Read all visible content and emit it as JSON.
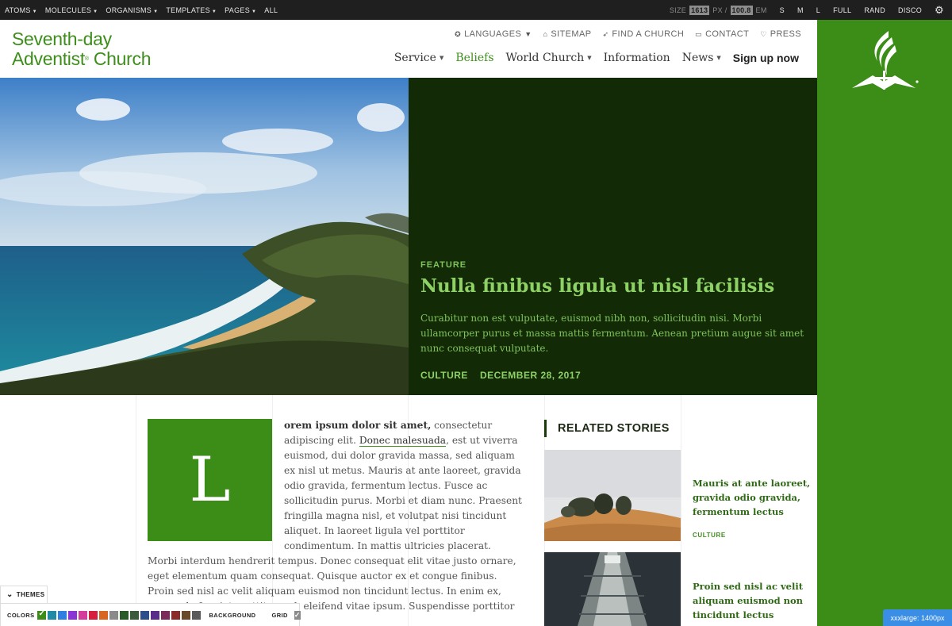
{
  "toolbar": {
    "nav": [
      {
        "label": "ATOMS",
        "has_caret": true
      },
      {
        "label": "MOLECULES",
        "has_caret": true
      },
      {
        "label": "ORGANISMS",
        "has_caret": true
      },
      {
        "label": "TEMPLATES",
        "has_caret": true
      },
      {
        "label": "PAGES",
        "has_caret": true
      },
      {
        "label": "ALL",
        "has_caret": false
      }
    ],
    "size_label": "SIZE",
    "px_value": "1613",
    "px_unit": "PX /",
    "em_value": "100.8",
    "em_unit": "EM",
    "sizes": [
      "S",
      "M",
      "L",
      "FULL",
      "RAND",
      "DISCO"
    ],
    "settings_icon": "gear-icon"
  },
  "header": {
    "logo_line1": "Seventh-day",
    "logo_line2": "Adventist",
    "logo_reg": "®",
    "logo_line2b": "Church",
    "utility_nav": [
      {
        "label": "LANGUAGES",
        "icon": "star-icon",
        "glyph": "✪",
        "caret": true
      },
      {
        "label": "SITEMAP",
        "icon": "bell-icon",
        "glyph": "⌂",
        "caret": false
      },
      {
        "label": "FIND A CHURCH",
        "icon": "pin-icon",
        "glyph": "➶",
        "caret": false
      },
      {
        "label": "CONTACT",
        "icon": "chat-icon",
        "glyph": "▭",
        "caret": false
      },
      {
        "label": "PRESS",
        "icon": "heart-icon",
        "glyph": "♡",
        "caret": false
      }
    ],
    "main_nav": [
      {
        "label": "Service",
        "caret": true,
        "active": false
      },
      {
        "label": "Beliefs",
        "caret": false,
        "active": true
      },
      {
        "label": "World Church",
        "caret": true,
        "active": false
      },
      {
        "label": "Information",
        "caret": false,
        "active": false
      },
      {
        "label": "News",
        "caret": true,
        "active": false
      }
    ],
    "cta": "Sign up now"
  },
  "hero": {
    "kicker": "FEATURE",
    "title": "Nulla finibus ligula ut nisl facilisis",
    "description": "Curabitur non est vulputate, euismod nibh non, sollicitudin nisi. Morbi ullamcorper purus et massa mattis fermentum. Aenean pretium augue sit amet nunc consequat vulputate.",
    "category": "CULTURE",
    "date": "DECEMBER 28, 2017"
  },
  "article": {
    "dropcap": "L",
    "lead_bold": "orem ipsum dolor sit amet,",
    "lead_rest": " consectetur adipiscing elit. ",
    "link": "Donec malesuada",
    "body": ", est ut viverra euismod, dui dolor gravida massa, sed aliquam ex nisl ut metus. Mauris at ante laoreet, gravida odio gravida, fermentum lectus. Fusce ac sollicitudin purus. Morbi et diam nunc. Praesent fringilla magna nisl, et volutpat nisi tincidunt aliquet. In laoreet ligula vel porttitor condimentum. In mattis ultricies placerat. Morbi interdum hendrerit tempus. Donec consequat elit vitae justo ornare, eget elementum quam consequat. Quisque auctor ex et congue finibus. Proin sed nisl ac velit aliquam euismod non tincidunt lectus. In enim ex, commodo feugiat porttitor sed, eleifend vitae ipsum. Suspendisse porttitor convallis sem."
  },
  "related": {
    "heading": "RELATED STORIES",
    "stories": [
      {
        "title": "Mauris at ante laoreet, gravida odio gravida, fermentum lectus",
        "tag": "CULTURE"
      },
      {
        "title": "Proin sed nisl ac velit aliquam euismod non tincidunt lectus",
        "tag": ""
      }
    ]
  },
  "themes": {
    "tab_label": "THEMES",
    "colors_label": "COLORS",
    "background_label": "BACKGROUND",
    "grid_label": "GRID",
    "swatches": [
      "#3b8d17",
      "#1f8aa6",
      "#2f7fe0",
      "#8b34d6",
      "#d43b9a",
      "#d61f3c",
      "#d8661e",
      "#8a8a8a",
      "#2a5a2a",
      "#3a5a3a",
      "#2c4e8a",
      "#5a2c8a",
      "#7a2c5a",
      "#8a2a2a",
      "#6a4a2a",
      "#5a5a5a"
    ],
    "selected_index": 0
  },
  "breakpoint_badge": "xxxlarge: 1400px",
  "colors": {
    "brand_green": "#3b8d17",
    "hero_panel": "#132a07",
    "hero_text": "#8ed266"
  }
}
